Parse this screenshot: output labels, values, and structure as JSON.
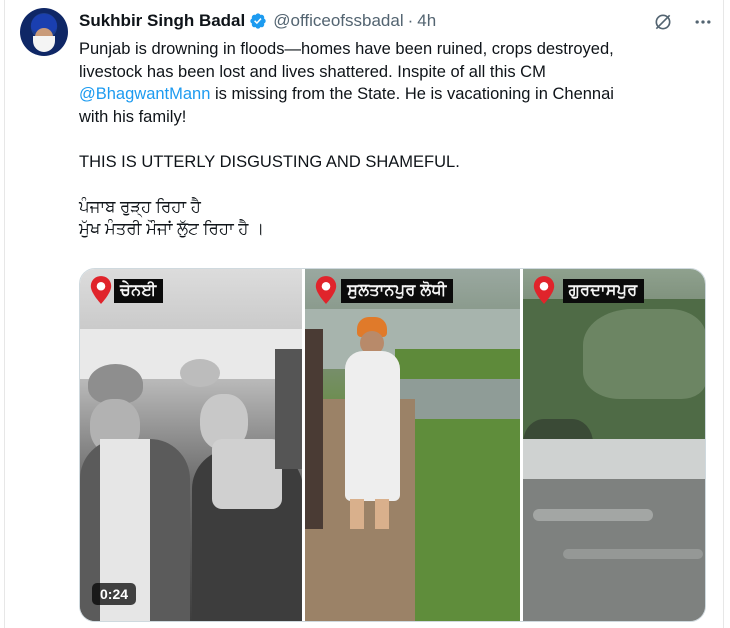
{
  "author": {
    "name": "Sukhbir Singh Badal",
    "handle": "@officeofssbadal",
    "separator": "·",
    "time": "4h"
  },
  "tweet": {
    "line1": "Punjab is drowning in floods—homes have been ruined, crops destroyed,",
    "line2": "livestock has been lost and lives shattered. Inspite of all this CM",
    "mention": "@BhagwantMann",
    "line3_rest": " is missing from the State. He is vacationing in Chennai",
    "line4": "with his family!",
    "line5": "THIS IS UTTERLY DISGUSTING AND SHAMEFUL.",
    "line6": "ਪੰਜਾਬ ਰੁੜ੍ਹ ਰਿਹਾ ਹੈ",
    "line7": "ਮੁੱਖ ਮੰਤਰੀ ਮੌਜਾਂ ਲੁੱਟ ਰਿਹਾ ਹੈ ।"
  },
  "media": {
    "panels": [
      {
        "label": "ਚੇਨਈ"
      },
      {
        "label": "ਸੁਲਤਾਨਪੁਰ ਲੋਧੀ"
      },
      {
        "label": "ਗੁਰਦਾਸਪੁਰ"
      }
    ],
    "duration": "0:24"
  },
  "colors": {
    "accent": "#1d9bf0",
    "text": "#0f1419",
    "muted": "#536471",
    "pin": "#e0242b"
  },
  "icons": [
    "verified-badge-icon",
    "grok-icon",
    "more-icon",
    "location-pin-icon"
  ]
}
